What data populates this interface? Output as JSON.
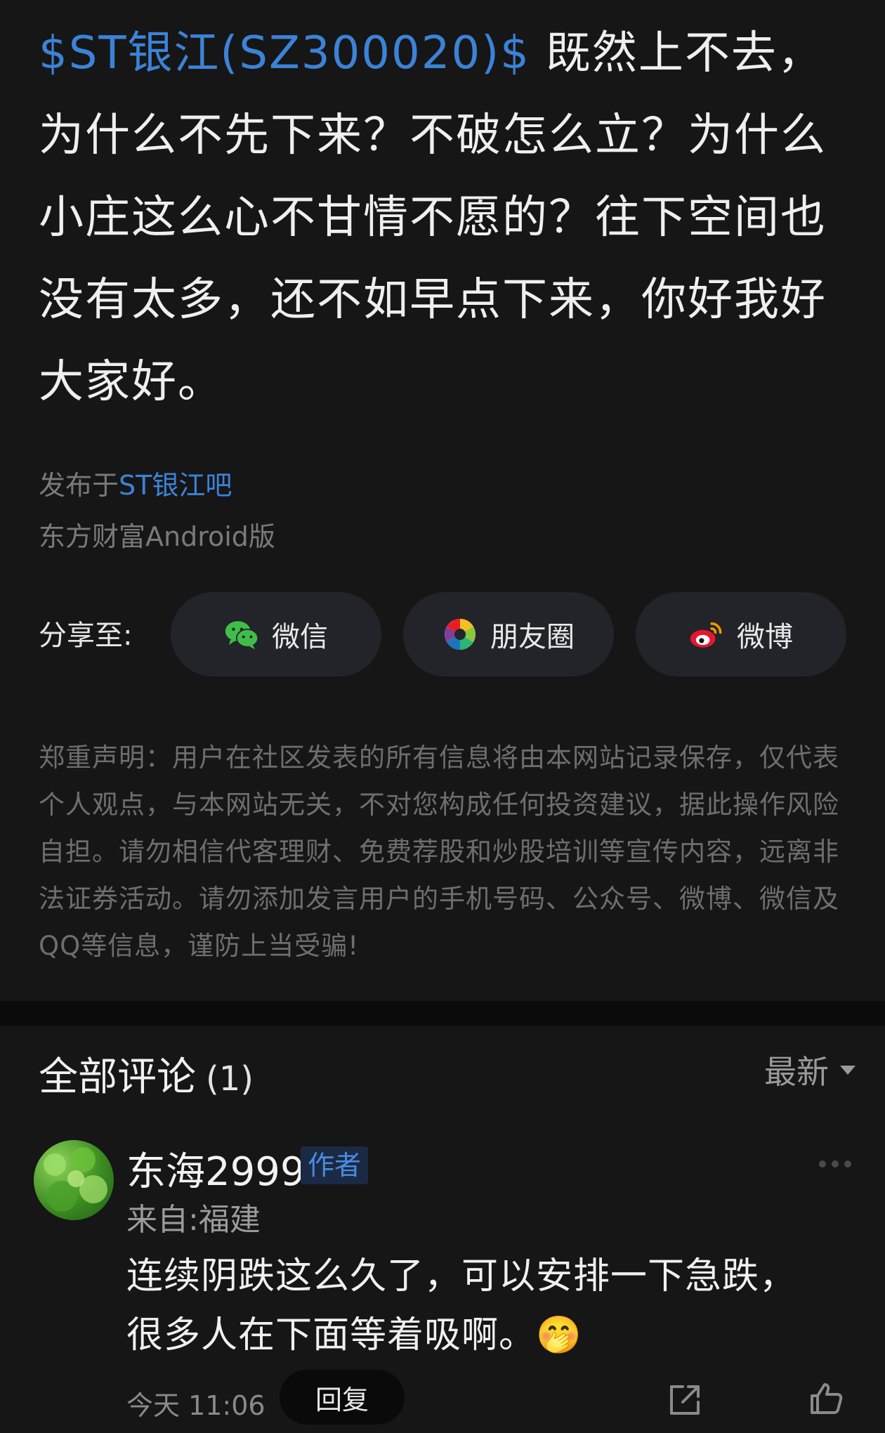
{
  "post": {
    "stock_tag": "$ST银江(SZ300020)$",
    "text": "既然上不去，为什么不先下来？不破怎么立？为什么小庄这么心不甘情不愿的？往下空间也没有太多，还不如早点下来，你好我好大家好。",
    "published_prefix": "发布于",
    "forum_name": "ST银江吧",
    "client": "东方财富Android版"
  },
  "share": {
    "label": "分享至:",
    "wechat": "微信",
    "moments": "朋友圈",
    "weibo": "微博"
  },
  "disclaimer": "郑重声明：用户在社区发表的所有信息将由本网站记录保存，仅代表个人观点，与本网站无关，不对您构成任何投资建议，据此操作风险自担。请勿相信代客理财、免费荐股和炒股培训等宣传内容，远离非法证券活动。请勿添加发言用户的手机号码、公众号、微博、微信及QQ等信息，谨防上当受骗!",
  "comments": {
    "title": "全部评论",
    "count": "(1)",
    "sort_label": "最新",
    "items": [
      {
        "username": "东海2999",
        "tag": "作者",
        "location": "来自:福建",
        "text": "连续阴跌这么久了，可以安排一下急跌，很多人在下面等着吸啊。",
        "emoji": "🤭",
        "time": "今天 11:06",
        "reply_label": "回复"
      }
    ]
  },
  "colors": {
    "background": "#161616",
    "link": "#3b83d8",
    "muted": "#7a7a7a"
  }
}
